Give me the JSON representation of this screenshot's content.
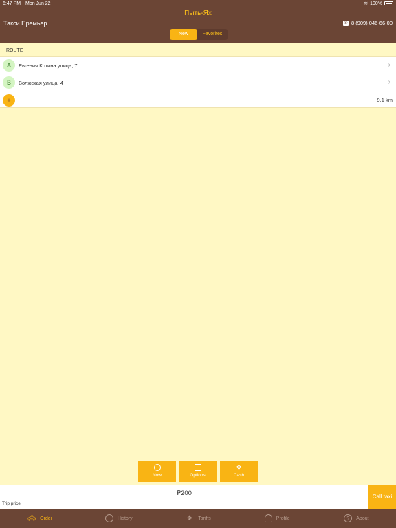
{
  "status_bar": {
    "time": "6:47 PM",
    "date": "Mon Jun 22",
    "battery": "100%"
  },
  "header": {
    "city": "Пыть-Ях",
    "company": "Такси Премьер",
    "phone": "8 (909) 046-66-00",
    "tabs": [
      "New",
      "Favorites"
    ],
    "selected_tab": "New"
  },
  "route": {
    "section_label": "ROUTE",
    "stops": [
      {
        "letter": "A",
        "address": "Евгения Котина улица, 7"
      },
      {
        "letter": "B",
        "address": "Волжская улица, 4"
      }
    ],
    "add_symbol": "+",
    "distance": "9.1 km"
  },
  "options": {
    "now_label": "Now",
    "options_label": "Options",
    "cash_label": "Cash"
  },
  "price_bar": {
    "price": "₽200",
    "trip_price_label": "Trip price",
    "call_taxi_label": "Call taxi"
  },
  "tabbar": {
    "active": "Order",
    "items": [
      {
        "label": "Order",
        "icon": "taxi-icon"
      },
      {
        "label": "History",
        "icon": "clock-icon"
      },
      {
        "label": "Tariffs",
        "icon": "money-icon"
      },
      {
        "label": "Profile",
        "icon": "person-icon"
      },
      {
        "label": "About",
        "icon": "question-icon"
      }
    ]
  },
  "colors": {
    "brand_brown": "#6b4535",
    "accent_yellow": "#f9b414",
    "background": "#fff8c4"
  }
}
